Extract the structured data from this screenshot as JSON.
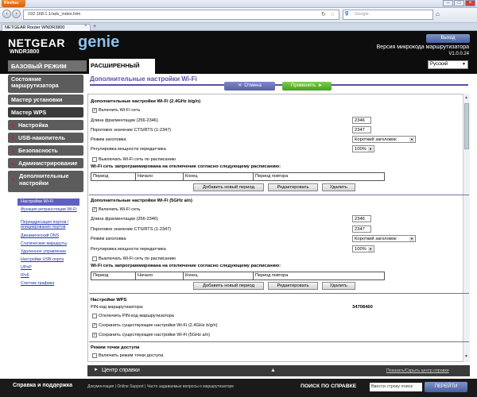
{
  "browser": {
    "app_button": "Firefox",
    "url": "192.168.1.1/adv_index.htm",
    "search_placeholder": "Google",
    "tab_title": "NETGEAR Router WNDR3800"
  },
  "header": {
    "brand": "NETGEAR",
    "genie": "genie",
    "model": "WNDR3800",
    "logout": "Выход",
    "fw_label": "Версия микрокода маршрутизатора",
    "fw_version": "V1.0.0.24",
    "language": "Русский",
    "tab_basic": "БАЗОВЫЙ РЕЖИМ",
    "tab_advanced": "РАСШИРЕННЫЙ"
  },
  "sidebar": {
    "items": [
      {
        "label": "Состояние маршрутизатора"
      },
      {
        "label": "Мастер установки"
      },
      {
        "label": "Мастер WPS"
      },
      {
        "label": "Настройка"
      },
      {
        "label": "USB-накопитель"
      },
      {
        "label": "Безопасность"
      },
      {
        "label": "Администрирование"
      },
      {
        "label": "Дополнительные настройки"
      }
    ],
    "subitems": [
      "Настройки Wi-Fi",
      "Функция ретрансляции Wi-Fi",
      "Переадресация портов / инициирование портов",
      "Динамический DNS",
      "Статические маршруты",
      "Удаленное управление",
      "Настройки USB-порта",
      "UPnP",
      "IPv6",
      "Счетчик трафика"
    ]
  },
  "main": {
    "title": "Дополнительные настройки Wi-Fi",
    "cancel": "Отмена",
    "apply": "Применить",
    "sec24": {
      "title": "Дополнительные настройки Wi-Fi (2.4GHz b/g/n)",
      "enable": "Включить Wi-Fi сеть",
      "frag_label": "Длина фрагментации (256-2346)",
      "frag_value": "2346",
      "cts_label": "Пороговое значение CTS/RTS (1-2347)",
      "cts_value": "2347",
      "preamble_label": "Режим заголовка",
      "preamble_value": "Короткий заголовок",
      "power_label": "Регулировка мощности передатчика",
      "power_value": "100%",
      "schedule_off": "Выключать Wi-Fi сеть по расписанию",
      "schedule_note": "Wi-Fi сеть запрограммирована на отключение согласно следующему расписанию:"
    },
    "sec5": {
      "title": "Дополнительные настройки Wi-Fi (5GHz a/n)",
      "enable": "Включить Wi-Fi сеть",
      "frag_label": "Длина фрагментации (256-2346)",
      "frag_value": "2346",
      "cts_label": "Пороговое значение CTS/RTS (1-2347)",
      "cts_value": "2347",
      "preamble_label": "Режим заголовка",
      "preamble_value": "Короткий заголовок",
      "power_label": "Регулировка мощности передатчика",
      "power_value": "100%",
      "schedule_off": "Выключать Wi-Fi сеть по расписанию",
      "schedule_note": "Wi-Fi сеть запрограммирована на отключение согласно следующему расписанию:"
    },
    "sched_cols": [
      "Период",
      "Начало",
      "Конец",
      "Период повтора"
    ],
    "sched_buttons": {
      "add": "Добавить новый период",
      "edit": "Редактировать",
      "delete": "Удалить"
    },
    "wps": {
      "title": "Настройки WPS",
      "pin_label": "PIN-код маршрутизатора:",
      "pin_value": "34708460",
      "disable_pin": "Отключить PIN-код маршрутизатора",
      "keep24": "Сохранить существующие настройки Wi-Fi (2.4GHz b/g/n)",
      "keep5": "Сохранить существующие настройки Wi-Fi (5GHz a/n)"
    },
    "ap": {
      "title": "Режим точки доступа",
      "enable": "Включить режим точки доступа"
    }
  },
  "help": {
    "title": "Центр справки",
    "toggle": "Показать/Скрыть центр справки"
  },
  "footer": {
    "title": "Справка и поддержка",
    "links": "Документация | Online Support | Часто задаваемые вопросы о маршрутизаторе",
    "search_label": "ПОИСК ПО СПРАВКЕ",
    "search_placeholder": "Ввести строку поиск",
    "search_button": "ПЕРЕЙТИ"
  }
}
